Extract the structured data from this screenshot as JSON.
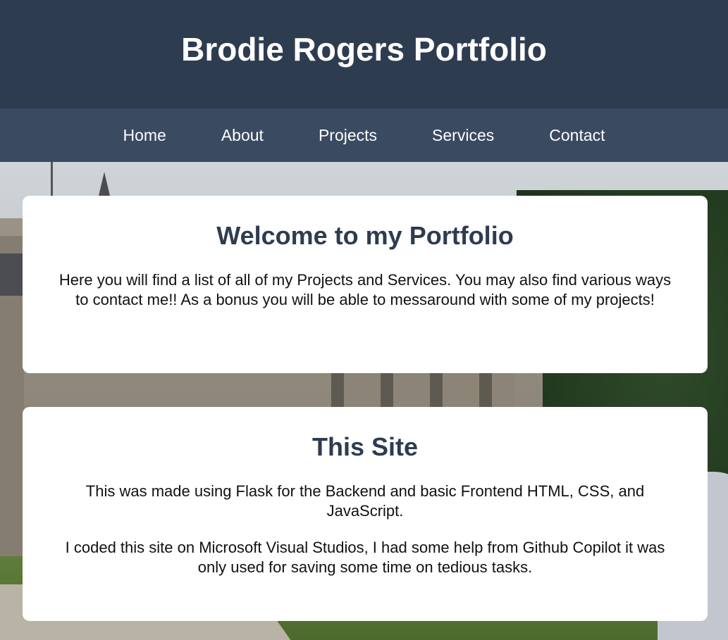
{
  "header": {
    "title": "Brodie Rogers Portfolio"
  },
  "nav": {
    "items": [
      {
        "label": "Home"
      },
      {
        "label": "About"
      },
      {
        "label": "Projects"
      },
      {
        "label": "Services"
      },
      {
        "label": "Contact"
      }
    ]
  },
  "welcome": {
    "heading": "Welcome to my Portfolio",
    "body": "Here you will find a list of all of my Projects and Services. You may also find various ways to contact me!! As a bonus you will be able to messaround with some of my projects!"
  },
  "this_site": {
    "heading": "This Site",
    "paragraphs": [
      "This was made using Flask for the Backend and basic Frontend HTML, CSS, and JavaScript.",
      "I coded this site on Microsoft Visual Studios, I had some help from Github Copilot it was only used for saving some time on tedious tasks."
    ]
  },
  "colors": {
    "header_bg": "#2e3c50",
    "nav_bg": "#3a4a61",
    "heading_text": "#2e3c50",
    "card_bg": "#ffffff"
  }
}
